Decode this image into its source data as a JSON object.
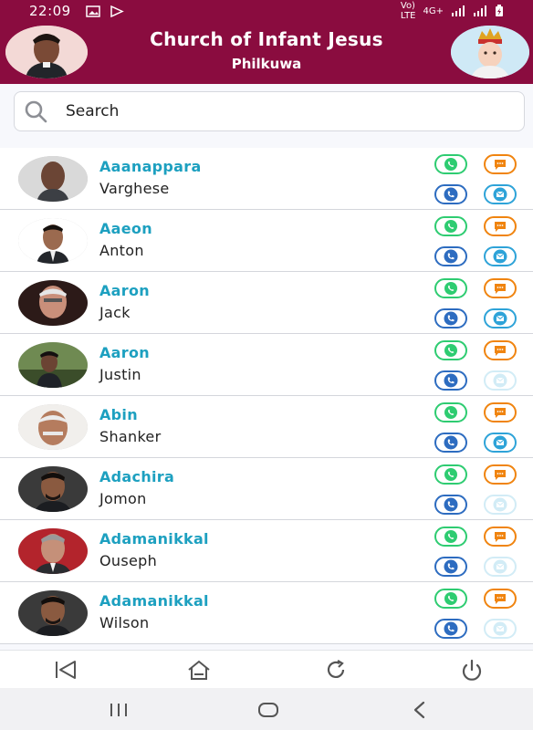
{
  "status_bar": {
    "time": "22:09",
    "network": "4G+"
  },
  "header": {
    "title": "Church of Infant Jesus",
    "subtitle": "Philkuwa",
    "color": "#8a0c3f"
  },
  "search": {
    "placeholder": "Search"
  },
  "accent": {
    "name_color": "#1da0c0",
    "whatsapp": "#2ecc71",
    "sms": "#f0840f",
    "call": "#2d6cc0",
    "mail": "#2ea3d8"
  },
  "contacts": [
    {
      "surname": "Aaanappara",
      "name": "Varghese",
      "mail_enabled": true
    },
    {
      "surname": "Aaeon",
      "name": "Anton",
      "mail_enabled": true
    },
    {
      "surname": "Aaron",
      "name": "Jack",
      "mail_enabled": true
    },
    {
      "surname": "Aaron",
      "name": "Justin",
      "mail_enabled": false
    },
    {
      "surname": "Abin",
      "name": "Shanker",
      "mail_enabled": true
    },
    {
      "surname": "Adachira",
      "name": "Jomon",
      "mail_enabled": false
    },
    {
      "surname": "Adamanikkal",
      "name": "Ouseph",
      "mail_enabled": false
    },
    {
      "surname": "Adamanikkal",
      "name": "Wilson",
      "mail_enabled": false
    }
  ],
  "bottom_bar": {
    "icons": [
      "back-icon",
      "home-icon",
      "refresh-icon",
      "power-icon"
    ]
  },
  "system_nav": {
    "icons": [
      "recent-apps-icon",
      "home-nav-icon",
      "back-nav-icon"
    ]
  }
}
